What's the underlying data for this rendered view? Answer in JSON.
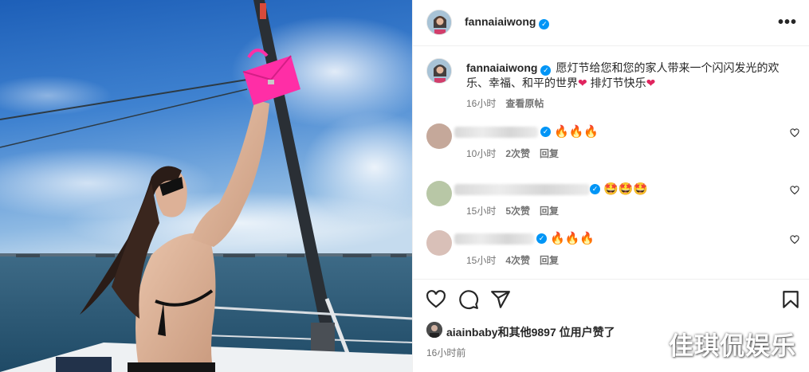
{
  "header": {
    "username": "fannaiaiwong",
    "more_label": "•••"
  },
  "caption": {
    "username": "fannaiaiwong",
    "text": "愿灯节给您和您的家人带来一个闪闪发光的欢乐、幸福、和平的世界",
    "text2": " 排灯节快乐",
    "heart": "❤",
    "time": "16小时",
    "view_original": "查看原帖"
  },
  "comments": [
    {
      "emoji": "🔥🔥🔥",
      "time": "10小时",
      "likes": "2次赞",
      "reply": "回复"
    },
    {
      "emoji": "🤩🤩🤩",
      "time": "15小时",
      "likes": "5次赞",
      "reply": "回复"
    },
    {
      "emoji": "🔥🔥🔥",
      "time": "15小时",
      "likes": "4次赞",
      "reply": "回复"
    }
  ],
  "likes": {
    "user": "aiainbaby",
    "rest": "和其他9897 位用户赞了"
  },
  "post_time": "16小时前",
  "watermark": "佳琪侃娱乐",
  "colors": {
    "verified": "#0095f6",
    "bag": "#ff2ea6",
    "text_primary": "#262626",
    "text_secondary": "#737373"
  },
  "icons": [
    "heart-icon",
    "comment-icon",
    "share-icon",
    "bookmark-icon",
    "more-icon",
    "verified-icon"
  ]
}
